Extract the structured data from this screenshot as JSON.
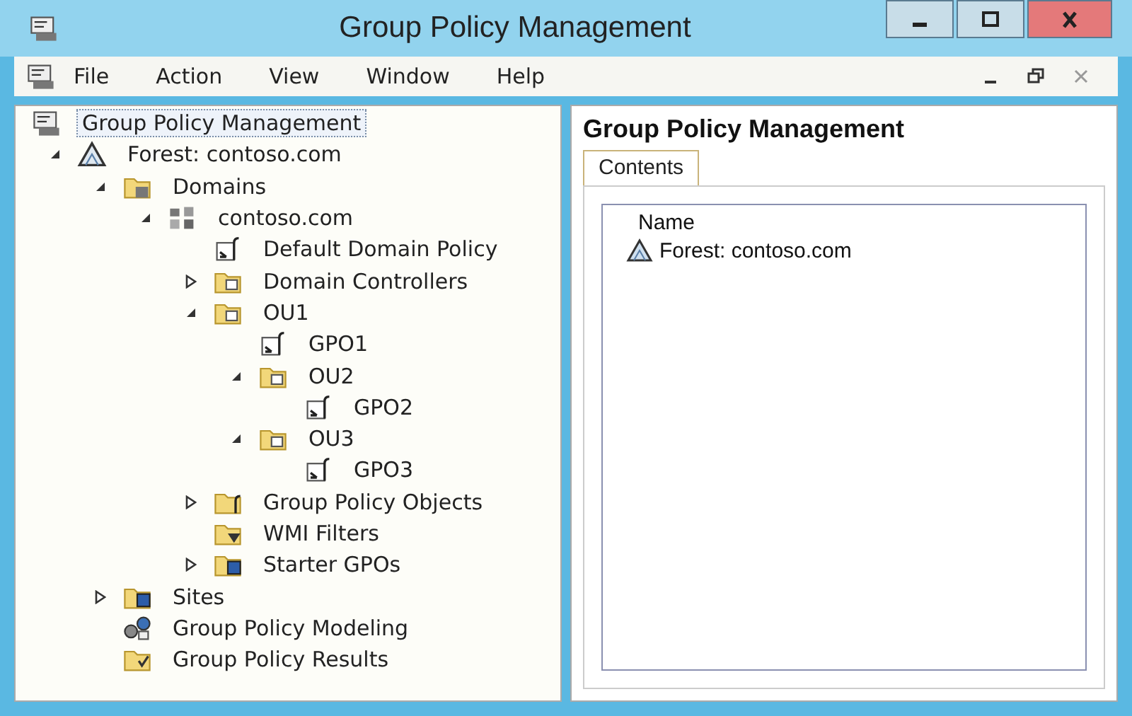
{
  "window": {
    "title": "Group Policy Management"
  },
  "menu": [
    {
      "label": "File"
    },
    {
      "label": "Action"
    },
    {
      "label": "View"
    },
    {
      "label": "Window"
    },
    {
      "label": "Help"
    }
  ],
  "tree": [
    {
      "label": "Group Policy Management",
      "kind": "console",
      "selected": true,
      "children": [
        {
          "label": "Forest: contoso.com",
          "kind": "forest",
          "selected": false,
          "expanded": true,
          "children": [
            {
              "label": "Domains",
              "kind": "domains",
              "selected": false,
              "expanded": true,
              "children": [
                {
                  "label": "contoso.com",
                  "kind": "domain",
                  "selected": false,
                  "expanded": true,
                  "children": [
                    {
                      "label": "Default Domain Policy",
                      "kind": "gpo",
                      "selected": false
                    },
                    {
                      "label": "Domain Controllers",
                      "kind": "ou",
                      "selected": false,
                      "expanded": false
                    },
                    {
                      "label": "OU1",
                      "kind": "ou",
                      "selected": false,
                      "expanded": true,
                      "children": [
                        {
                          "label": "GPO1",
                          "kind": "gpo",
                          "selected": false
                        },
                        {
                          "label": "OU2",
                          "kind": "ou",
                          "selected": false,
                          "expanded": true,
                          "children": [
                            {
                              "label": "GPO2",
                              "kind": "gpo",
                              "selected": false
                            }
                          ]
                        },
                        {
                          "label": "OU3",
                          "kind": "ou",
                          "selected": false,
                          "expanded": true,
                          "children": [
                            {
                              "label": "GPO3",
                              "kind": "gpo",
                              "selected": false
                            }
                          ]
                        }
                      ]
                    },
                    {
                      "label": "Group Policy Objects",
                      "kind": "gpofolder",
                      "selected": false,
                      "expanded": false
                    },
                    {
                      "label": "WMI Filters",
                      "kind": "wmi",
                      "selected": false
                    },
                    {
                      "label": "Starter GPOs",
                      "kind": "starter",
                      "selected": false,
                      "expanded": false
                    }
                  ]
                }
              ]
            },
            {
              "label": "Sites",
              "kind": "sites",
              "selected": false,
              "expanded": false
            },
            {
              "label": "Group Policy Modeling",
              "kind": "modeling",
              "selected": false
            },
            {
              "label": "Group Policy Results",
              "kind": "results",
              "selected": false
            }
          ]
        }
      ]
    }
  ],
  "details": {
    "title": "Group Policy Management",
    "tabs": [
      {
        "label": "Contents",
        "selected": true
      }
    ],
    "columns": [
      "Name"
    ],
    "rows": [
      {
        "name": "Forest: contoso.com",
        "kind": "forest"
      }
    ]
  }
}
